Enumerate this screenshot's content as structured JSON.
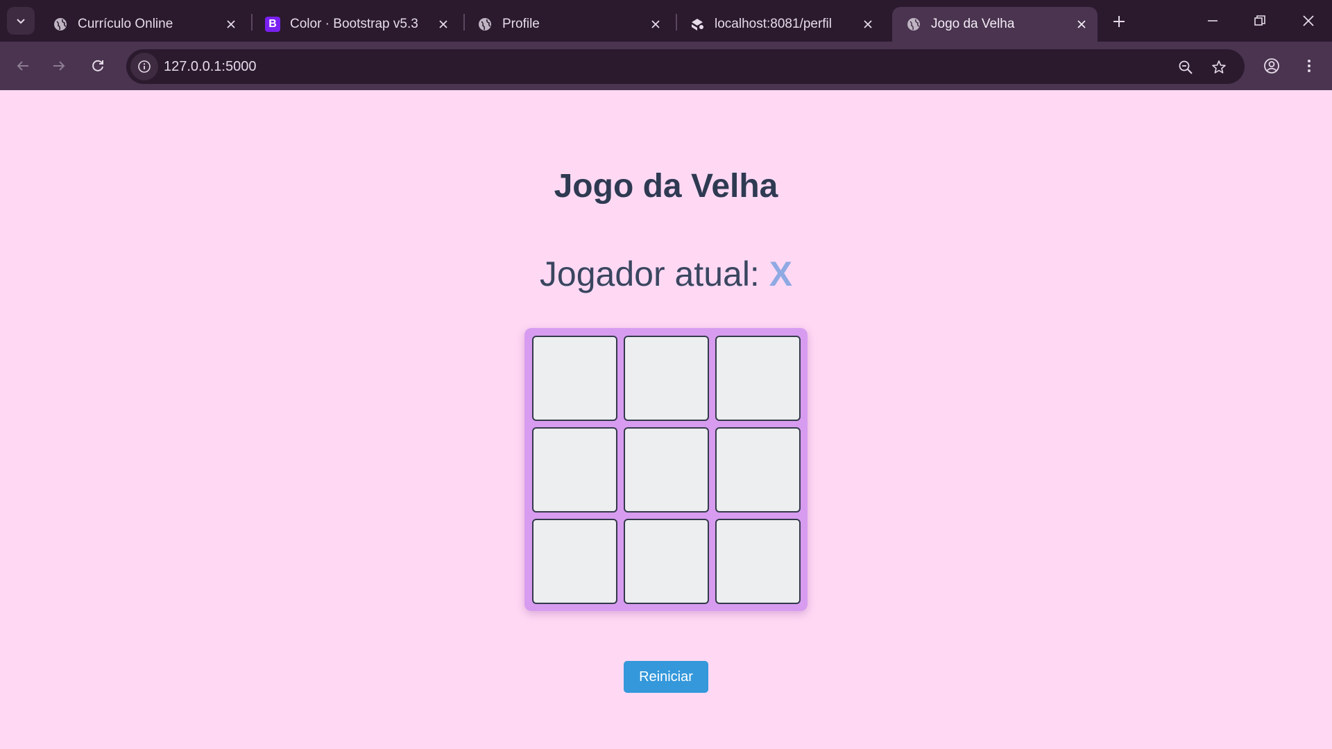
{
  "browser": {
    "tabs": [
      {
        "title": "Currículo Online",
        "favicon": "globe-icon",
        "active": false
      },
      {
        "title": "Color · Bootstrap v5.3",
        "favicon": "bootstrap-icon",
        "active": false
      },
      {
        "title": "Profile",
        "favicon": "globe-icon",
        "active": false
      },
      {
        "title": "localhost:8081/perfil",
        "favicon": "puzzle-icon",
        "active": false
      },
      {
        "title": "Jogo da Velha",
        "favicon": "globe-icon",
        "active": true
      }
    ],
    "bootstrap_glyph": "B",
    "address": "127.0.0.1:5000",
    "colors": {
      "tabstrip": "#2b1a2e",
      "toolbar": "#4a3450",
      "bootstrap": "#7a20f0"
    }
  },
  "game": {
    "title": "Jogo da Velha",
    "status_label": "Jogador atual: ",
    "current_player": "X",
    "board": [
      "",
      "",
      "",
      "",
      "",
      "",
      "",
      "",
      ""
    ],
    "reset_label": "Reiniciar",
    "colors": {
      "background": "#ffd9f4",
      "board": "#d79cf0",
      "cell": "#eceeef",
      "player": "#8fa9e3",
      "button": "#3498db"
    }
  }
}
